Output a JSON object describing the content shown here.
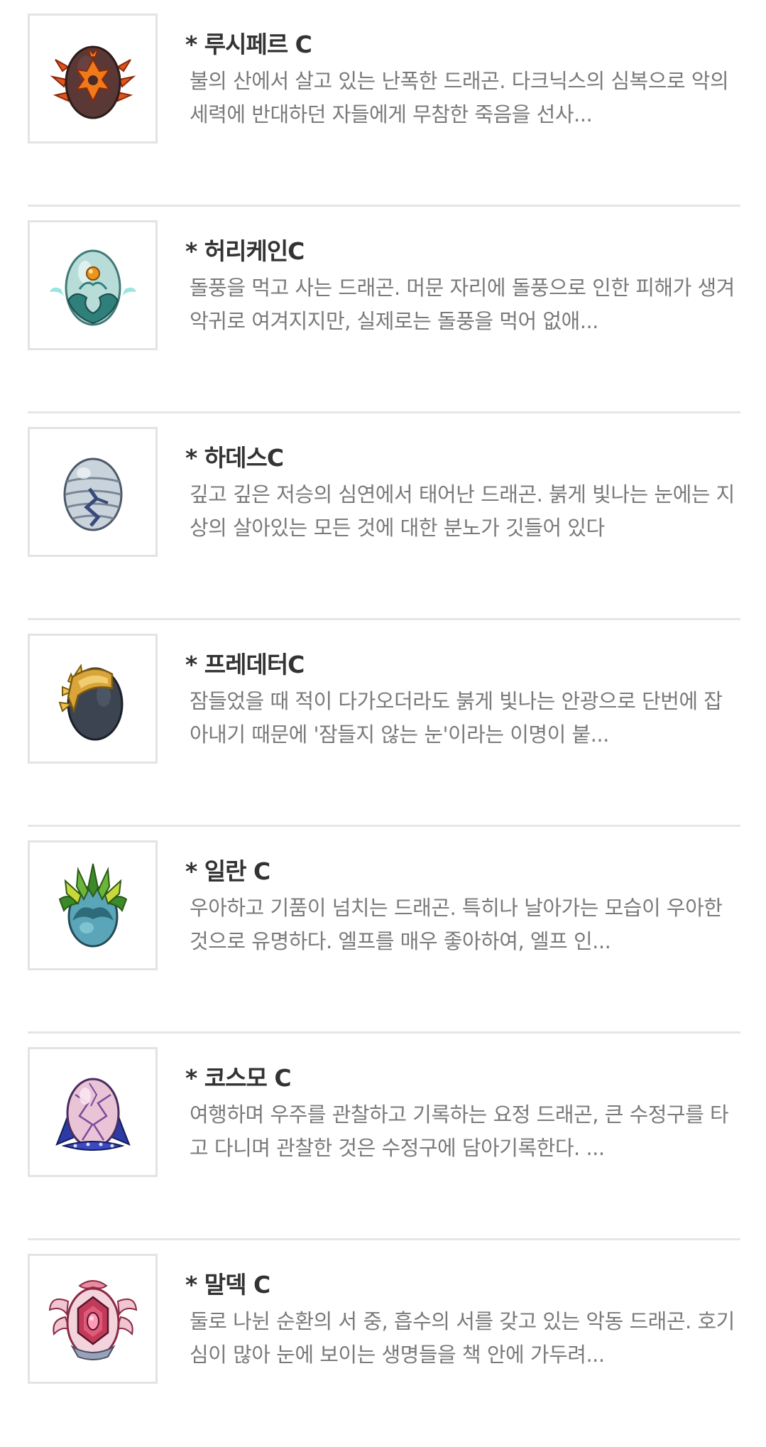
{
  "dragons": [
    {
      "name": "* 루시페르 C",
      "description": "불의 산에서 살고 있는 난폭한 드래곤. 다크닉스의 심복으로 악의 세력에 반대하던 자들에게 무참한 죽음을 선사...",
      "icon": "lucifer-egg-icon"
    },
    {
      "name": "* 허리케인C",
      "description": "돌풍을 먹고 사는 드래곤. 머문 자리에 돌풍으로 인한 피해가 생겨 악귀로 여겨지지만, 실제로는 돌풍을 먹어 없애...",
      "icon": "hurricane-egg-icon"
    },
    {
      "name": "* 하데스C",
      "description": "깊고 깊은 저승의 심연에서 태어난 드래곤. 붉게 빛나는 눈에는 지상의 살아있는 모든 것에 대한 분노가 깃들어 있다",
      "icon": "hades-egg-icon"
    },
    {
      "name": "* 프레데터C",
      "description": "잠들었을 때 적이 다가오더라도 붉게 빛나는 안광으로 단번에 잡아내기 때문에 '잠들지 않는 눈'이라는 이명이 붙...",
      "icon": "predator-egg-icon"
    },
    {
      "name": "* 일란 C",
      "description": "우아하고 기품이 넘치는 드래곤. 특히나 날아가는 모습이 우아한 것으로 유명하다. 엘프를 매우 좋아하여, 엘프 인...",
      "icon": "ilan-egg-icon"
    },
    {
      "name": "* 코스모 C",
      "description": "여행하며 우주를 관찰하고 기록하는 요정 드래곤, 큰 수정구를 타고 다니며 관찰한 것은 수정구에 담아기록한다. ...",
      "icon": "cosmo-egg-icon"
    },
    {
      "name": "* 말덱 C",
      "description": "둘로 나뉜 순환의 서 중, 흡수의 서를 갖고 있는 악동 드래곤. 호기심이 많아 눈에 보이는 생명들을 책 안에 가두려...",
      "icon": "maldek-egg-icon"
    }
  ]
}
